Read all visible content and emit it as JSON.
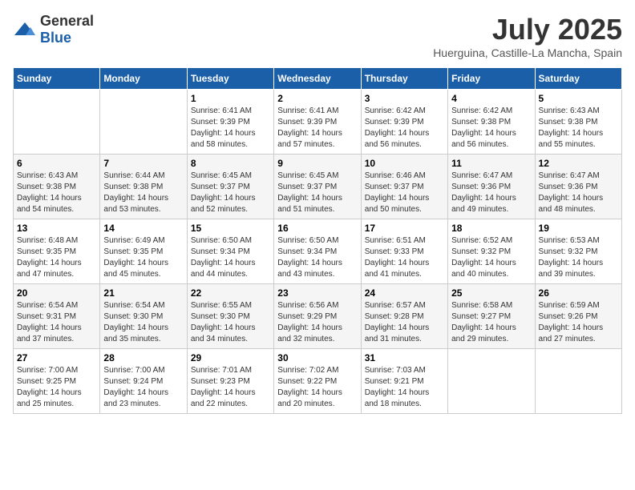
{
  "header": {
    "logo_general": "General",
    "logo_blue": "Blue",
    "month_year": "July 2025",
    "location": "Huerguina, Castille-La Mancha, Spain"
  },
  "calendar": {
    "weekdays": [
      "Sunday",
      "Monday",
      "Tuesday",
      "Wednesday",
      "Thursday",
      "Friday",
      "Saturday"
    ],
    "weeks": [
      [
        {
          "day": null,
          "sunrise": null,
          "sunset": null,
          "daylight": null
        },
        {
          "day": null,
          "sunrise": null,
          "sunset": null,
          "daylight": null
        },
        {
          "day": 1,
          "sunrise": "Sunrise: 6:41 AM",
          "sunset": "Sunset: 9:39 PM",
          "daylight": "Daylight: 14 hours and 58 minutes."
        },
        {
          "day": 2,
          "sunrise": "Sunrise: 6:41 AM",
          "sunset": "Sunset: 9:39 PM",
          "daylight": "Daylight: 14 hours and 57 minutes."
        },
        {
          "day": 3,
          "sunrise": "Sunrise: 6:42 AM",
          "sunset": "Sunset: 9:39 PM",
          "daylight": "Daylight: 14 hours and 56 minutes."
        },
        {
          "day": 4,
          "sunrise": "Sunrise: 6:42 AM",
          "sunset": "Sunset: 9:38 PM",
          "daylight": "Daylight: 14 hours and 56 minutes."
        },
        {
          "day": 5,
          "sunrise": "Sunrise: 6:43 AM",
          "sunset": "Sunset: 9:38 PM",
          "daylight": "Daylight: 14 hours and 55 minutes."
        }
      ],
      [
        {
          "day": 6,
          "sunrise": "Sunrise: 6:43 AM",
          "sunset": "Sunset: 9:38 PM",
          "daylight": "Daylight: 14 hours and 54 minutes."
        },
        {
          "day": 7,
          "sunrise": "Sunrise: 6:44 AM",
          "sunset": "Sunset: 9:38 PM",
          "daylight": "Daylight: 14 hours and 53 minutes."
        },
        {
          "day": 8,
          "sunrise": "Sunrise: 6:45 AM",
          "sunset": "Sunset: 9:37 PM",
          "daylight": "Daylight: 14 hours and 52 minutes."
        },
        {
          "day": 9,
          "sunrise": "Sunrise: 6:45 AM",
          "sunset": "Sunset: 9:37 PM",
          "daylight": "Daylight: 14 hours and 51 minutes."
        },
        {
          "day": 10,
          "sunrise": "Sunrise: 6:46 AM",
          "sunset": "Sunset: 9:37 PM",
          "daylight": "Daylight: 14 hours and 50 minutes."
        },
        {
          "day": 11,
          "sunrise": "Sunrise: 6:47 AM",
          "sunset": "Sunset: 9:36 PM",
          "daylight": "Daylight: 14 hours and 49 minutes."
        },
        {
          "day": 12,
          "sunrise": "Sunrise: 6:47 AM",
          "sunset": "Sunset: 9:36 PM",
          "daylight": "Daylight: 14 hours and 48 minutes."
        }
      ],
      [
        {
          "day": 13,
          "sunrise": "Sunrise: 6:48 AM",
          "sunset": "Sunset: 9:35 PM",
          "daylight": "Daylight: 14 hours and 47 minutes."
        },
        {
          "day": 14,
          "sunrise": "Sunrise: 6:49 AM",
          "sunset": "Sunset: 9:35 PM",
          "daylight": "Daylight: 14 hours and 45 minutes."
        },
        {
          "day": 15,
          "sunrise": "Sunrise: 6:50 AM",
          "sunset": "Sunset: 9:34 PM",
          "daylight": "Daylight: 14 hours and 44 minutes."
        },
        {
          "day": 16,
          "sunrise": "Sunrise: 6:50 AM",
          "sunset": "Sunset: 9:34 PM",
          "daylight": "Daylight: 14 hours and 43 minutes."
        },
        {
          "day": 17,
          "sunrise": "Sunrise: 6:51 AM",
          "sunset": "Sunset: 9:33 PM",
          "daylight": "Daylight: 14 hours and 41 minutes."
        },
        {
          "day": 18,
          "sunrise": "Sunrise: 6:52 AM",
          "sunset": "Sunset: 9:32 PM",
          "daylight": "Daylight: 14 hours and 40 minutes."
        },
        {
          "day": 19,
          "sunrise": "Sunrise: 6:53 AM",
          "sunset": "Sunset: 9:32 PM",
          "daylight": "Daylight: 14 hours and 39 minutes."
        }
      ],
      [
        {
          "day": 20,
          "sunrise": "Sunrise: 6:54 AM",
          "sunset": "Sunset: 9:31 PM",
          "daylight": "Daylight: 14 hours and 37 minutes."
        },
        {
          "day": 21,
          "sunrise": "Sunrise: 6:54 AM",
          "sunset": "Sunset: 9:30 PM",
          "daylight": "Daylight: 14 hours and 35 minutes."
        },
        {
          "day": 22,
          "sunrise": "Sunrise: 6:55 AM",
          "sunset": "Sunset: 9:30 PM",
          "daylight": "Daylight: 14 hours and 34 minutes."
        },
        {
          "day": 23,
          "sunrise": "Sunrise: 6:56 AM",
          "sunset": "Sunset: 9:29 PM",
          "daylight": "Daylight: 14 hours and 32 minutes."
        },
        {
          "day": 24,
          "sunrise": "Sunrise: 6:57 AM",
          "sunset": "Sunset: 9:28 PM",
          "daylight": "Daylight: 14 hours and 31 minutes."
        },
        {
          "day": 25,
          "sunrise": "Sunrise: 6:58 AM",
          "sunset": "Sunset: 9:27 PM",
          "daylight": "Daylight: 14 hours and 29 minutes."
        },
        {
          "day": 26,
          "sunrise": "Sunrise: 6:59 AM",
          "sunset": "Sunset: 9:26 PM",
          "daylight": "Daylight: 14 hours and 27 minutes."
        }
      ],
      [
        {
          "day": 27,
          "sunrise": "Sunrise: 7:00 AM",
          "sunset": "Sunset: 9:25 PM",
          "daylight": "Daylight: 14 hours and 25 minutes."
        },
        {
          "day": 28,
          "sunrise": "Sunrise: 7:00 AM",
          "sunset": "Sunset: 9:24 PM",
          "daylight": "Daylight: 14 hours and 23 minutes."
        },
        {
          "day": 29,
          "sunrise": "Sunrise: 7:01 AM",
          "sunset": "Sunset: 9:23 PM",
          "daylight": "Daylight: 14 hours and 22 minutes."
        },
        {
          "day": 30,
          "sunrise": "Sunrise: 7:02 AM",
          "sunset": "Sunset: 9:22 PM",
          "daylight": "Daylight: 14 hours and 20 minutes."
        },
        {
          "day": 31,
          "sunrise": "Sunrise: 7:03 AM",
          "sunset": "Sunset: 9:21 PM",
          "daylight": "Daylight: 14 hours and 18 minutes."
        },
        {
          "day": null,
          "sunrise": null,
          "sunset": null,
          "daylight": null
        },
        {
          "day": null,
          "sunrise": null,
          "sunset": null,
          "daylight": null
        }
      ]
    ]
  }
}
